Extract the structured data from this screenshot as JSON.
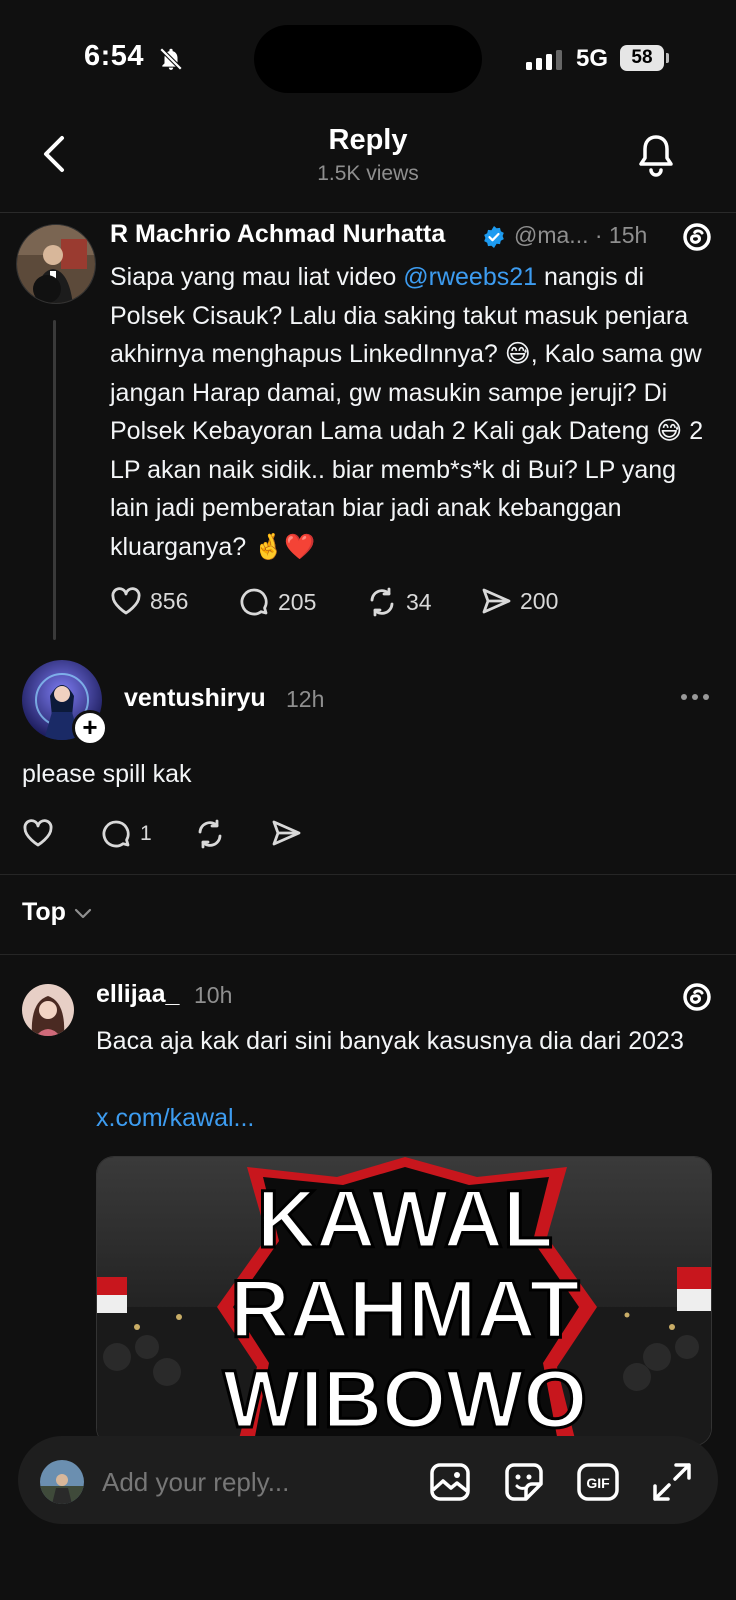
{
  "status_bar": {
    "time": "6:54",
    "network": "5G",
    "battery": "58"
  },
  "header": {
    "title": "Reply",
    "views": "1.5K views"
  },
  "main_post": {
    "author": "R Machrio Achmad Nurhatta",
    "handle_time": "@ma... · 15h",
    "text_parts": [
      "Siapa yang mau liat video ",
      "@rweebs21",
      " nangis di Polsek Cisauk? Lalu dia saking takut masuk penjara akhirnya menghapus LinkedInnya? 😅, Kalo sama gw jangan Harap damai, gw masukin sampe jeruji? Di Polsek Kebayoran Lama udah 2 Kali gak Dateng 😅 2 LP akan naik sidik.. biar memb*s*k di Bui? LP yang lain jadi pemberatan biar jadi anak kebanggan kluarganya? 🤞❤️"
    ],
    "likes": "856",
    "replies": "205",
    "reposts": "34",
    "shares": "200"
  },
  "reply": {
    "username": "ventushiryu",
    "time": "12h",
    "text": "please spill kak",
    "reply_count": "1"
  },
  "sort": {
    "label": "Top"
  },
  "comment": {
    "username": "ellijaa_",
    "time": "10h",
    "text": "Baca aja kak dari sini banyak kasusnya dia dari 2023",
    "link": "x.com/kawal...",
    "embed_lines": [
      "KAWAL",
      "RAHMAT",
      "WIBOWO"
    ]
  },
  "composer": {
    "placeholder": "Add your reply...",
    "gif_label": "GIF"
  },
  "colors": {
    "background": "#101010",
    "link": "#3d9cf0",
    "secondary_text": "#8f8f8f",
    "verified": "#1d9bf0",
    "banner_red": "#c8161d"
  }
}
